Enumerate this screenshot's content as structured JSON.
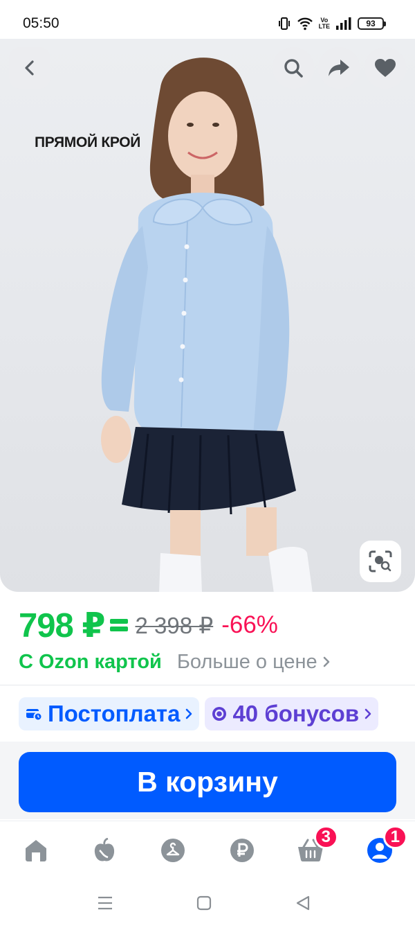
{
  "status_bar": {
    "time": "05:50",
    "battery": "93",
    "network_label_top": "Vo",
    "network_label_bottom": "LTE"
  },
  "hero": {
    "caption": "ПРЯМОЙ КРОЙ",
    "buttons": [
      "back-icon",
      "search-icon",
      "share-icon",
      "heart-icon",
      "visual-search-icon"
    ]
  },
  "price": {
    "current": "798 ₽",
    "old": "2 398 ₽",
    "discount": "-66%",
    "card_label": "С Ozon картой",
    "more_label": "Больше о цене"
  },
  "chips": {
    "postpay": "Постоплата",
    "bonus": "40 бонусов"
  },
  "cart_button": "В корзину",
  "bottom_nav": {
    "items": [
      "home-icon",
      "fresh-icon",
      "catalog-icon",
      "finance-icon",
      "cart-icon",
      "profile-icon"
    ],
    "cart_badge": "3",
    "profile_badge": "1",
    "active": "profile"
  },
  "colors": {
    "accent": "#005bff",
    "price_green": "#10c44c",
    "discount_pink": "#f91155",
    "bonus_purple": "#5d3fd3"
  }
}
